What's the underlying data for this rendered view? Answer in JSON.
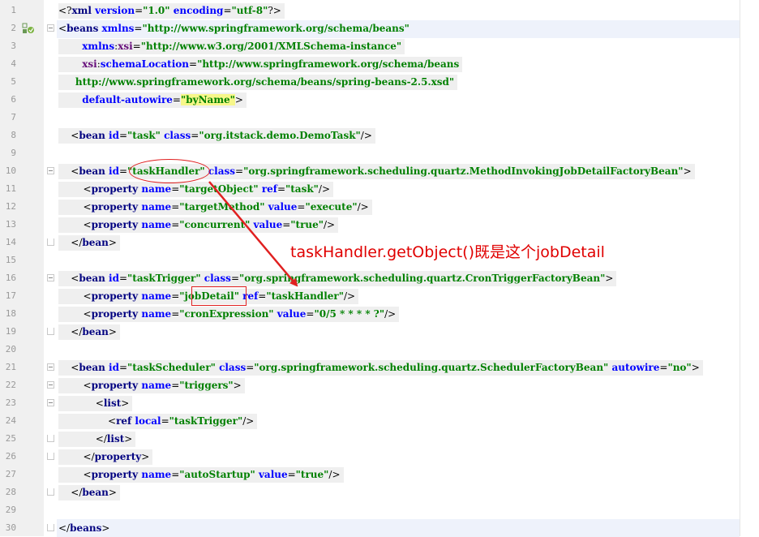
{
  "editor": {
    "lines": [
      {
        "n": "1",
        "segments": [
          [
            "punct",
            "<?"
          ],
          [
            "tag",
            "xml "
          ],
          [
            "attr",
            "version"
          ],
          [
            "punct",
            "="
          ],
          [
            "val",
            "\"1.0\""
          ],
          [
            "attr",
            " encoding"
          ],
          [
            "punct",
            "="
          ],
          [
            "val",
            "\"utf-8\""
          ],
          [
            "punct",
            "?>"
          ]
        ]
      },
      {
        "n": "2",
        "segments": [
          [
            "punct",
            "<"
          ],
          [
            "tag",
            "beans "
          ],
          [
            "attr",
            "xmlns"
          ],
          [
            "punct",
            "="
          ],
          [
            "val",
            "\"http://www.springframework.org/schema/beans\""
          ]
        ]
      },
      {
        "n": "3",
        "segments": [
          [
            "attr",
            "       xmlns"
          ],
          [
            "punct",
            ":"
          ],
          [
            "ns",
            "xsi"
          ],
          [
            "punct",
            "="
          ],
          [
            "val",
            "\"http://www.w3.org/2001/XMLSchema-instance\""
          ]
        ]
      },
      {
        "n": "4",
        "segments": [
          [
            "ns",
            "       xsi"
          ],
          [
            "punct",
            ":"
          ],
          [
            "attr",
            "schemaLocation"
          ],
          [
            "punct",
            "="
          ],
          [
            "val",
            "\"http://www.springframework.org/schema/beans"
          ]
        ]
      },
      {
        "n": "5",
        "segments": [
          [
            "val",
            "     http://www.springframework.org/schema/beans/spring-beans-2.5.xsd\""
          ]
        ]
      },
      {
        "n": "6",
        "segments": [
          [
            "attr",
            "       default-autowire"
          ],
          [
            "punct",
            "="
          ],
          [
            "val",
            "\"byName\""
          ],
          [
            "punct",
            ">"
          ]
        ]
      },
      {
        "n": "7",
        "segments": []
      },
      {
        "n": "8",
        "segments": [
          [
            "punct",
            "    <"
          ],
          [
            "tag",
            "bean "
          ],
          [
            "attr",
            "id"
          ],
          [
            "punct",
            "="
          ],
          [
            "val",
            "\"task\""
          ],
          [
            "attr",
            " class"
          ],
          [
            "punct",
            "="
          ],
          [
            "val",
            "\"org.itstack.demo.DemoTask\""
          ],
          [
            "punct",
            "/>"
          ]
        ]
      },
      {
        "n": "9",
        "segments": []
      },
      {
        "n": "10",
        "segments": [
          [
            "punct",
            "    <"
          ],
          [
            "tag",
            "bean "
          ],
          [
            "attr",
            "id"
          ],
          [
            "punct",
            "="
          ],
          [
            "val",
            "\"taskHandler\""
          ],
          [
            "attr",
            " class"
          ],
          [
            "punct",
            "="
          ],
          [
            "val",
            "\"org.springframework.scheduling.quartz.MethodInvokingJobDetailFactoryBean\""
          ],
          [
            "punct",
            ">"
          ]
        ]
      },
      {
        "n": "11",
        "segments": [
          [
            "punct",
            "        <"
          ],
          [
            "tag",
            "property "
          ],
          [
            "attr",
            "name"
          ],
          [
            "punct",
            "="
          ],
          [
            "val",
            "\"targetObject\""
          ],
          [
            "attr",
            " ref"
          ],
          [
            "punct",
            "="
          ],
          [
            "val",
            "\"task\""
          ],
          [
            "punct",
            "/>"
          ]
        ]
      },
      {
        "n": "12",
        "segments": [
          [
            "punct",
            "        <"
          ],
          [
            "tag",
            "property "
          ],
          [
            "attr",
            "name"
          ],
          [
            "punct",
            "="
          ],
          [
            "val",
            "\"targetMethod\""
          ],
          [
            "attr",
            " value"
          ],
          [
            "punct",
            "="
          ],
          [
            "val",
            "\"execute\""
          ],
          [
            "punct",
            "/>"
          ]
        ]
      },
      {
        "n": "13",
        "segments": [
          [
            "punct",
            "        <"
          ],
          [
            "tag",
            "property "
          ],
          [
            "attr",
            "name"
          ],
          [
            "punct",
            "="
          ],
          [
            "val",
            "\"concurrent\""
          ],
          [
            "attr",
            " value"
          ],
          [
            "punct",
            "="
          ],
          [
            "val",
            "\"true\""
          ],
          [
            "punct",
            "/>"
          ]
        ]
      },
      {
        "n": "14",
        "segments": [
          [
            "punct",
            "    </"
          ],
          [
            "tag",
            "bean"
          ],
          [
            "punct",
            ">"
          ]
        ]
      },
      {
        "n": "15",
        "segments": []
      },
      {
        "n": "16",
        "segments": [
          [
            "punct",
            "    <"
          ],
          [
            "tag",
            "bean "
          ],
          [
            "attr",
            "id"
          ],
          [
            "punct",
            "="
          ],
          [
            "val",
            "\"taskTrigger\""
          ],
          [
            "attr",
            " class"
          ],
          [
            "punct",
            "="
          ],
          [
            "val",
            "\"org.springframework.scheduling.quartz.CronTriggerFactoryBean\""
          ],
          [
            "punct",
            ">"
          ]
        ]
      },
      {
        "n": "17",
        "segments": [
          [
            "punct",
            "        <"
          ],
          [
            "tag",
            "property "
          ],
          [
            "attr",
            "name"
          ],
          [
            "punct",
            "="
          ],
          [
            "val",
            "\"jobDetail\""
          ],
          [
            "attr",
            " ref"
          ],
          [
            "punct",
            "="
          ],
          [
            "val",
            "\"taskHandler\""
          ],
          [
            "punct",
            "/>"
          ]
        ]
      },
      {
        "n": "18",
        "segments": [
          [
            "punct",
            "        <"
          ],
          [
            "tag",
            "property "
          ],
          [
            "attr",
            "name"
          ],
          [
            "punct",
            "="
          ],
          [
            "val",
            "\"cronExpression\""
          ],
          [
            "attr",
            " value"
          ],
          [
            "punct",
            "="
          ],
          [
            "val",
            "\"0/5 * * * * ?\""
          ],
          [
            "punct",
            "/>"
          ]
        ]
      },
      {
        "n": "19",
        "segments": [
          [
            "punct",
            "    </"
          ],
          [
            "tag",
            "bean"
          ],
          [
            "punct",
            ">"
          ]
        ]
      },
      {
        "n": "20",
        "segments": []
      },
      {
        "n": "21",
        "segments": [
          [
            "punct",
            "    <"
          ],
          [
            "tag",
            "bean "
          ],
          [
            "attr",
            "id"
          ],
          [
            "punct",
            "="
          ],
          [
            "val",
            "\"taskScheduler\""
          ],
          [
            "attr",
            " class"
          ],
          [
            "punct",
            "="
          ],
          [
            "val",
            "\"org.springframework.scheduling.quartz.SchedulerFactoryBean\""
          ],
          [
            "attr",
            " autowire"
          ],
          [
            "punct",
            "="
          ],
          [
            "val",
            "\"no\""
          ],
          [
            "punct",
            ">"
          ]
        ]
      },
      {
        "n": "22",
        "segments": [
          [
            "punct",
            "        <"
          ],
          [
            "tag",
            "property "
          ],
          [
            "attr",
            "name"
          ],
          [
            "punct",
            "="
          ],
          [
            "val",
            "\"triggers\""
          ],
          [
            "punct",
            ">"
          ]
        ]
      },
      {
        "n": "23",
        "segments": [
          [
            "punct",
            "            <"
          ],
          [
            "tag",
            "list"
          ],
          [
            "punct",
            ">"
          ]
        ]
      },
      {
        "n": "24",
        "segments": [
          [
            "punct",
            "                <"
          ],
          [
            "tag",
            "ref "
          ],
          [
            "attr",
            "local"
          ],
          [
            "punct",
            "="
          ],
          [
            "val",
            "\"taskTrigger\""
          ],
          [
            "punct",
            "/>"
          ]
        ]
      },
      {
        "n": "25",
        "segments": [
          [
            "punct",
            "            </"
          ],
          [
            "tag",
            "list"
          ],
          [
            "punct",
            ">"
          ]
        ]
      },
      {
        "n": "26",
        "segments": [
          [
            "punct",
            "        </"
          ],
          [
            "tag",
            "property"
          ],
          [
            "punct",
            ">"
          ]
        ]
      },
      {
        "n": "27",
        "segments": [
          [
            "punct",
            "        <"
          ],
          [
            "tag",
            "property "
          ],
          [
            "attr",
            "name"
          ],
          [
            "punct",
            "="
          ],
          [
            "val",
            "\"autoStartup\""
          ],
          [
            "attr",
            " value"
          ],
          [
            "punct",
            "="
          ],
          [
            "val",
            "\"true\""
          ],
          [
            "punct",
            "/>"
          ]
        ]
      },
      {
        "n": "28",
        "segments": [
          [
            "punct",
            "    </"
          ],
          [
            "tag",
            "bean"
          ],
          [
            "punct",
            ">"
          ]
        ]
      },
      {
        "n": "29",
        "segments": []
      },
      {
        "n": "30",
        "segments": [
          [
            "punct",
            "</"
          ],
          [
            "tag",
            "beans"
          ],
          [
            "punct",
            ">"
          ]
        ]
      }
    ]
  },
  "annotation": {
    "text": "taskHandler.getObject()既是这个jobDetail",
    "color": "#e00000"
  }
}
